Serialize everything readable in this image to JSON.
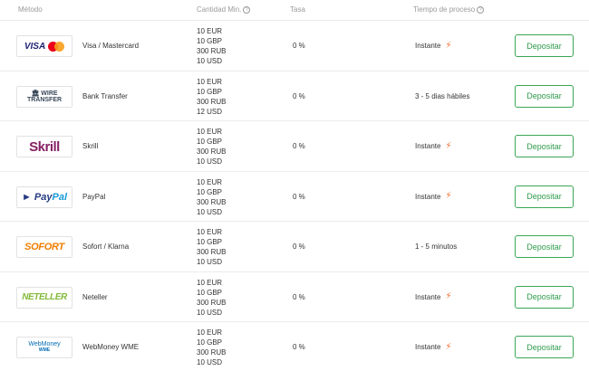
{
  "header": {
    "method": "Método",
    "min_amount": "Cantidad Min.",
    "fee": "Tasa",
    "processing_time": "Tiempo de proceso"
  },
  "rows": [
    {
      "name": "Visa / Mastercard",
      "logo_icon": "visa-mastercard-logo",
      "amounts": [
        "10 EUR",
        "10 GBP",
        "300 RUB",
        "10 USD"
      ],
      "fee": "0 %",
      "time": "Instante",
      "instant": true,
      "button": "Depositar"
    },
    {
      "name": "Bank Transfer",
      "logo_icon": "wire-transfer-logo",
      "amounts": [
        "10 EUR",
        "10 GBP",
        "300 RUB",
        "12 USD"
      ],
      "fee": "0 %",
      "time": "3 - 5 dias hábiles",
      "instant": false,
      "button": "Depositar"
    },
    {
      "name": "Skrill",
      "logo_icon": "skrill-logo",
      "amounts": [
        "10 EUR",
        "10 GBP",
        "300 RUB",
        "10 USD"
      ],
      "fee": "0 %",
      "time": "Instante",
      "instant": true,
      "button": "Depositar"
    },
    {
      "name": "PayPal",
      "logo_icon": "paypal-logo",
      "amounts": [
        "10 EUR",
        "10 GBP",
        "300 RUB",
        "10 USD"
      ],
      "fee": "0 %",
      "time": "Instante",
      "instant": true,
      "button": "Depositar"
    },
    {
      "name": "Sofort / Klarna",
      "logo_icon": "sofort-logo",
      "amounts": [
        "10 EUR",
        "10 GBP",
        "300 RUB",
        "10 USD"
      ],
      "fee": "0 %",
      "time": "1 - 5 minutos",
      "instant": false,
      "button": "Depositar"
    },
    {
      "name": "Neteller",
      "logo_icon": "neteller-logo",
      "amounts": [
        "10 EUR",
        "10 GBP",
        "300 RUB",
        "10 USD"
      ],
      "fee": "0 %",
      "time": "Instante",
      "instant": true,
      "button": "Depositar"
    },
    {
      "name": "WebMoney WME",
      "logo_icon": "webmoney-logo",
      "amounts": [
        "10 EUR",
        "10 GBP",
        "300 RUB",
        "10 USD"
      ],
      "fee": "0 %",
      "time": "Instante",
      "instant": true,
      "button": "Depositar"
    }
  ],
  "logos": {
    "visa": "VISA",
    "mastercard": "mastercard",
    "wire_1": "WIRE",
    "wire_2": "TRANSFER",
    "skrill": "Skrill",
    "paypal_1": "Pay",
    "paypal_2": "Pal",
    "sofort": "SOFORT",
    "neteller": "NETELLER",
    "webmoney_1": "WebMoney",
    "webmoney_2": "WME"
  },
  "colors": {
    "accent_green": "#3aa655",
    "bolt_orange": "#f26a2e"
  }
}
